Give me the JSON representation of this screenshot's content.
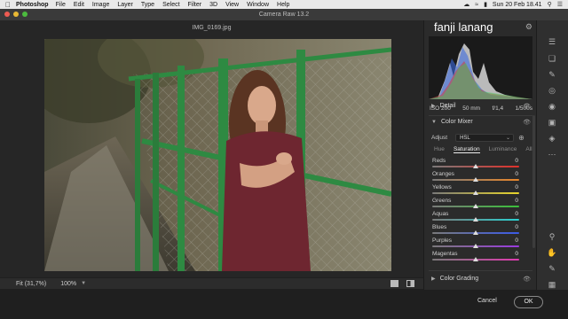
{
  "menubar": {
    "apple_icon": "apple-icon",
    "app_name": "Photoshop",
    "items": [
      "File",
      "Edit",
      "Image",
      "Layer",
      "Type",
      "Select",
      "Filter",
      "3D",
      "View",
      "Window",
      "Help"
    ],
    "datetime": "Sun 20 Feb 18.41"
  },
  "window": {
    "title": "Camera Raw 13.2"
  },
  "workspace": {
    "filename": "IMG_0169.jpg",
    "fit_label": "Fit (31,7%)",
    "zoom_value": "100%"
  },
  "panel": {
    "brand": "fanji lanang",
    "exif": {
      "iso": "ISO 200",
      "focal": "50 mm",
      "aperture": "f/1,4",
      "shutter": "1/500s"
    },
    "detail_label": "Detail",
    "color_mixer_label": "Color Mixer",
    "adjust_label": "Adjust",
    "adjust_value": "HSL",
    "tabs": [
      "Hue",
      "Saturation",
      "Luminance",
      "All"
    ],
    "active_tab": "Saturation",
    "sliders": [
      {
        "label": "Reds",
        "value": "0",
        "gradient": [
          "#7a7a7a",
          "#e0302a"
        ]
      },
      {
        "label": "Oranges",
        "value": "0",
        "gradient": [
          "#7a7a7a",
          "#e8862a"
        ]
      },
      {
        "label": "Yellows",
        "value": "0",
        "gradient": [
          "#7a7a7a",
          "#e8d52a"
        ]
      },
      {
        "label": "Greens",
        "value": "0",
        "gradient": [
          "#7a7a7a",
          "#3ac03a"
        ]
      },
      {
        "label": "Aquas",
        "value": "0",
        "gradient": [
          "#7a7a7a",
          "#2ad0d0"
        ]
      },
      {
        "label": "Blues",
        "value": "0",
        "gradient": [
          "#7a7a7a",
          "#3a5ae8"
        ]
      },
      {
        "label": "Purples",
        "value": "0",
        "gradient": [
          "#7a7a7a",
          "#9a3ae0"
        ]
      },
      {
        "label": "Magentas",
        "value": "0",
        "gradient": [
          "#7a7a7a",
          "#e03ab0"
        ]
      }
    ],
    "color_grading_label": "Color Grading"
  },
  "buttons": {
    "cancel": "Cancel",
    "ok": "OK"
  }
}
